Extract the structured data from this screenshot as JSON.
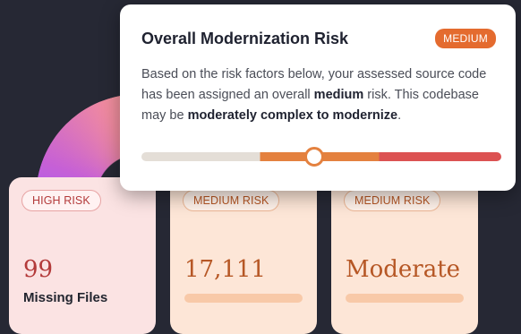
{
  "popover": {
    "title": "Overall Modernization Risk",
    "badge": "MEDIUM",
    "text_before": "Based on the risk factors below, your assessed source code has been assigned an overall ",
    "text_bold1": "medium",
    "text_mid": " risk. This codebase may be ",
    "text_bold2": "moderately complex to modernize",
    "text_after": ".",
    "risk_level_fraction": 0.48
  },
  "cards": [
    {
      "pill": "HIGH RISK",
      "value": "99",
      "label": "Missing Files"
    },
    {
      "pill": "MEDIUM RISK",
      "value": "17,111"
    },
    {
      "pill": "MEDIUM RISK",
      "value": "Moderate"
    }
  ],
  "colors": {
    "background": "#262834",
    "high": "#b33a3a",
    "medium": "#e46b2f",
    "low_track": "#e4ded7",
    "high_track": "#dc5252"
  }
}
